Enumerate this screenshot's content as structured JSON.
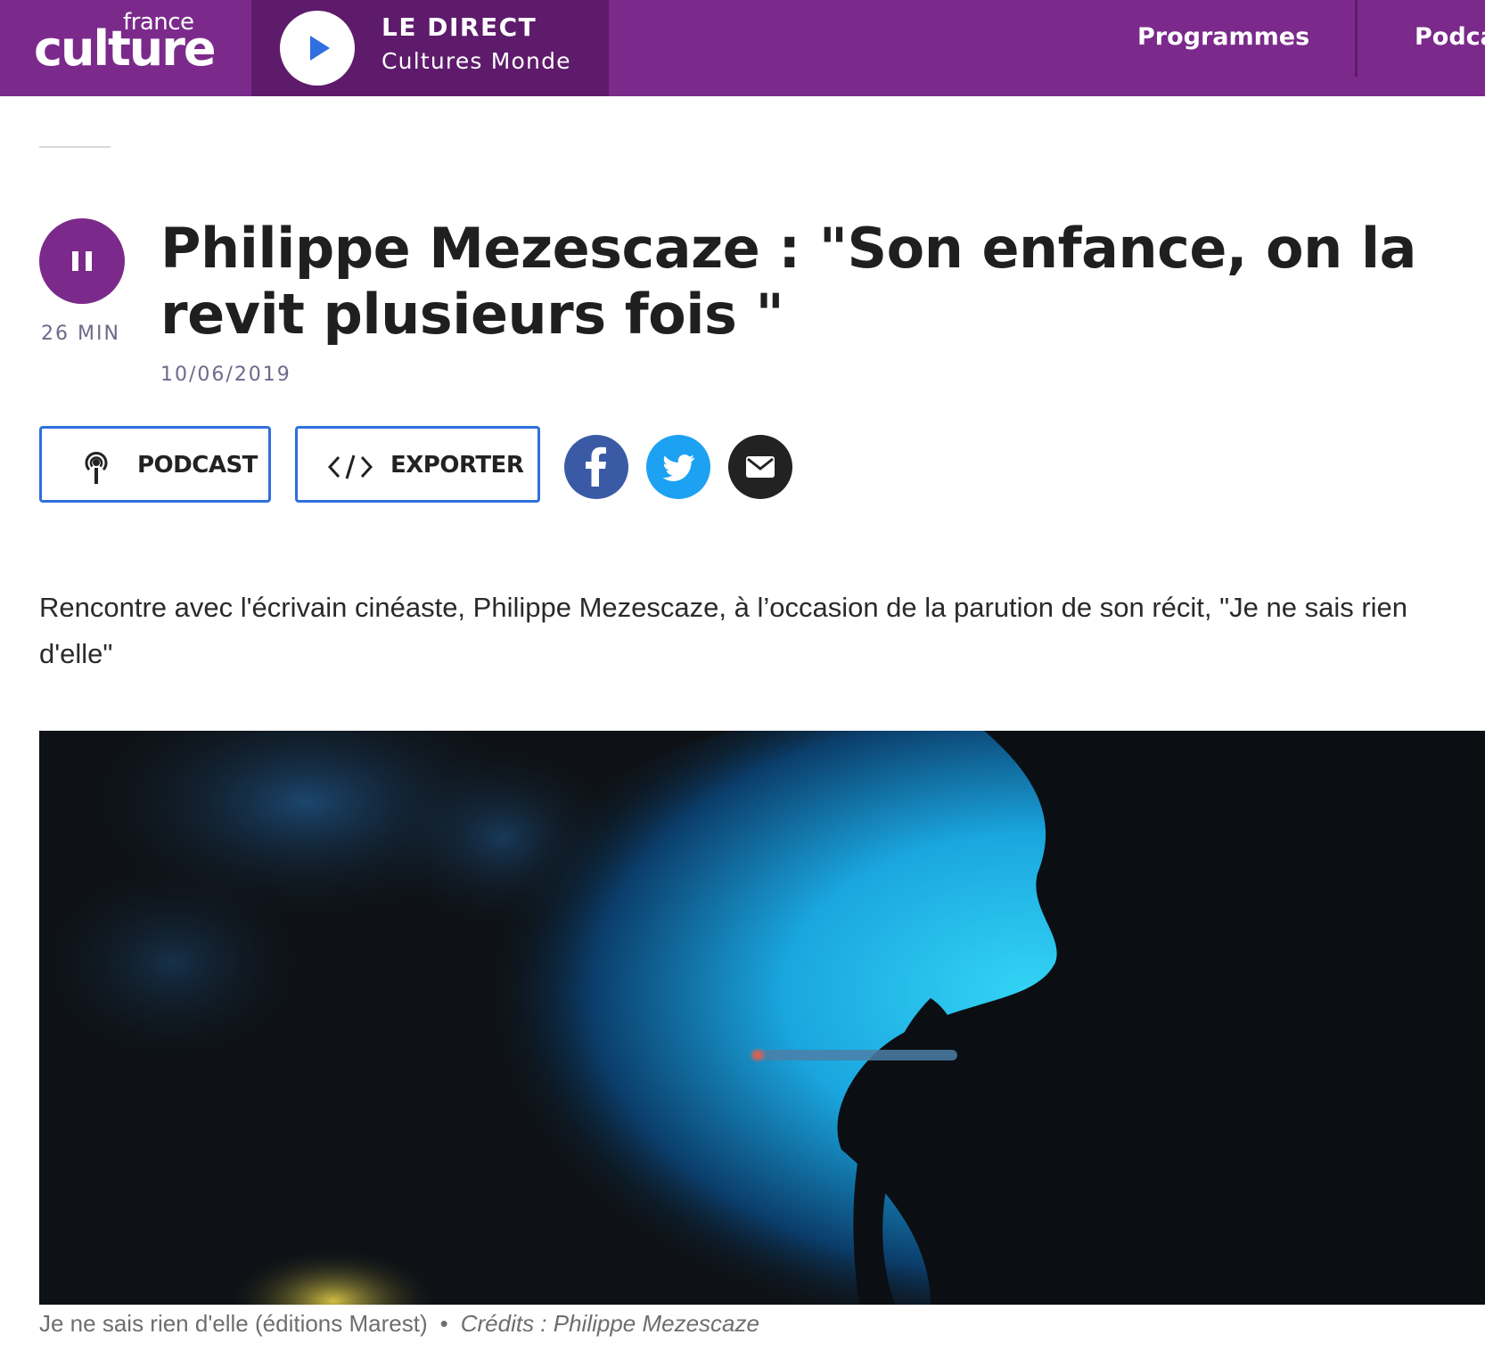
{
  "brand": {
    "logo_small": "france",
    "logo_big": "culture"
  },
  "live": {
    "label": "LE DIRECT",
    "station": "Cultures Monde"
  },
  "nav": {
    "items": [
      "Programmes",
      "Podca"
    ]
  },
  "episode": {
    "duration": "26 MIN",
    "title": "Philippe Mezescaze : \"Son enfance, on la revit plusieurs fois \"",
    "date": "10/06/2019"
  },
  "actions": {
    "podcast_label": "PODCAST",
    "export_label": "EXPORTER",
    "share": [
      "facebook-icon",
      "twitter-icon",
      "email-icon"
    ]
  },
  "article": {
    "lead": "Rencontre avec l'écrivain cinéaste, Philippe Mezescaze, à l’occasion de la parution de son récit, \"Je ne sais rien d'elle\""
  },
  "image": {
    "caption": "Je ne sais rien d'elle (éditions Marest)",
    "credit": "Crédits : Philippe Mezescaze"
  },
  "colors": {
    "brand_purple": "#7b2a8b",
    "live_purple": "#5e1b6b",
    "button_border": "#2f6fe0",
    "facebook": "#3b5aa5",
    "twitter": "#1da1f2",
    "email": "#222222"
  }
}
